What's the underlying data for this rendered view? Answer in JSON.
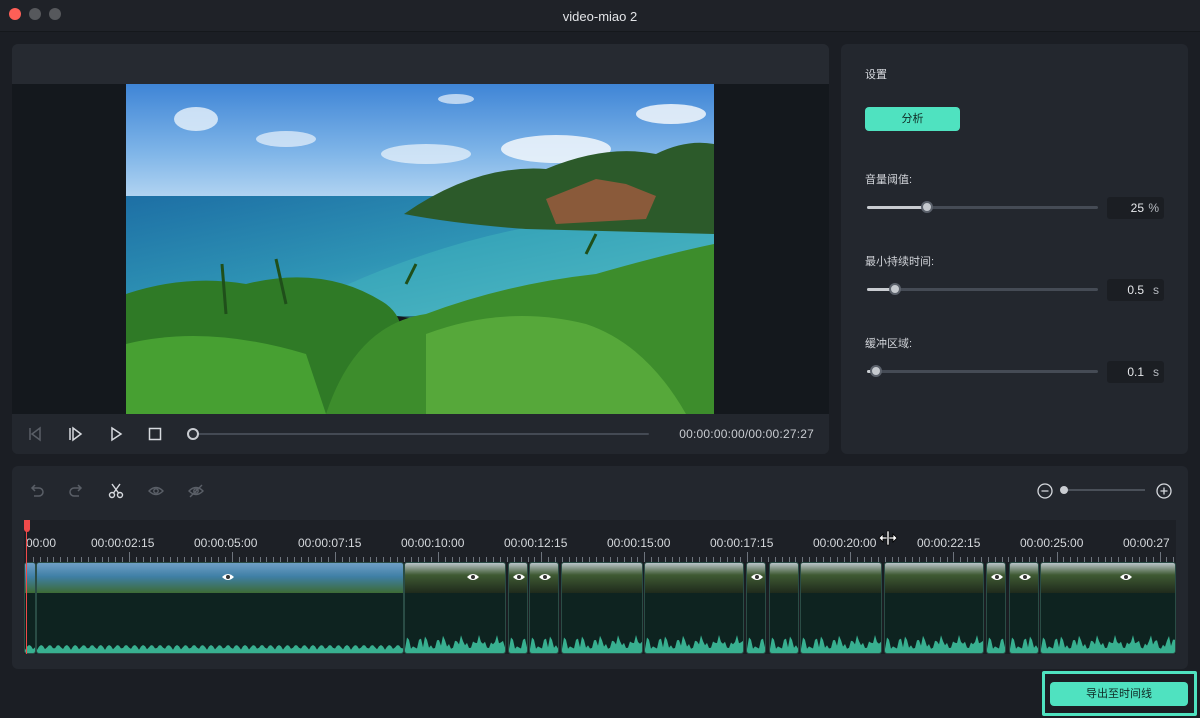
{
  "window": {
    "title": "video-miao 2"
  },
  "player": {
    "timecode": "00:00:00:00/00:00:27:27",
    "progress": 0
  },
  "settings": {
    "title": "设置",
    "analyze_label": "分析",
    "params": [
      {
        "label": "音量阈值:",
        "value": "25",
        "unit": "%",
        "level": 0.26
      },
      {
        "label": "最小持续时间:",
        "value": "0.5",
        "unit": "s",
        "level": 0.12
      },
      {
        "label": "缓冲区域:",
        "value": "0.1",
        "unit": "s",
        "level": 0.04
      }
    ]
  },
  "timeline": {
    "ruler_labels": [
      "00:00",
      "00:00:02:15",
      "00:00:05:00",
      "00:00:07:15",
      "00:00:10:00",
      "00:00:12:15",
      "00:00:15:00",
      "00:00:17:15",
      "00:00:20:00",
      "00:00:22:15",
      "00:00:25:00",
      "00:00:27"
    ],
    "zoom_level": 0.05
  },
  "export": {
    "label": "导出至时间线"
  },
  "colors": {
    "accent": "#4fe2c0",
    "playhead": "#f04a4a"
  },
  "icons": [
    "prev-frame-icon",
    "step-forward-icon",
    "play-icon",
    "stop-icon",
    "undo-icon",
    "redo-icon",
    "scissors-icon",
    "eye-icon",
    "eye-off-icon",
    "zoom-out-icon",
    "zoom-in-icon"
  ]
}
